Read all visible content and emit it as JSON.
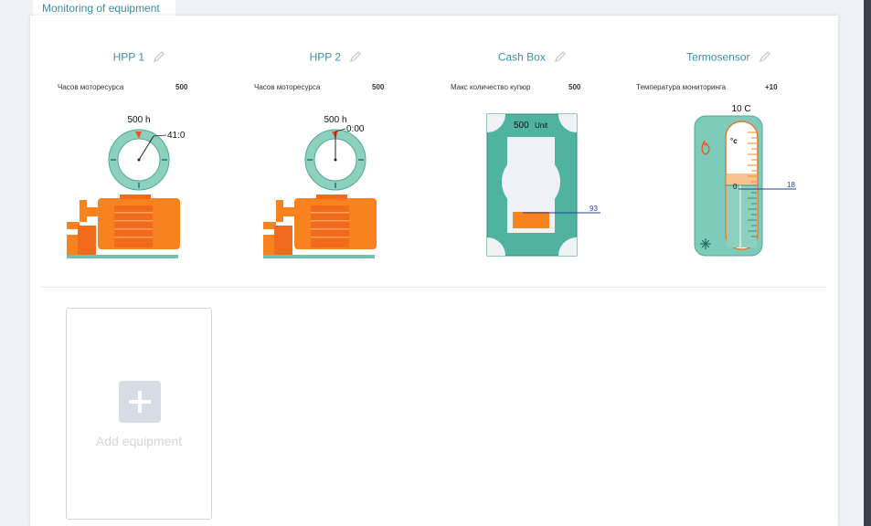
{
  "tab": {
    "label": "Monitoring of equipment"
  },
  "colors": {
    "accent": "#3d8fa8",
    "teal": "#4fb3a0",
    "orange": "#f7821e",
    "line": "#23408e"
  },
  "cards": [
    {
      "title": "HPP 1",
      "param_label": "Часов моторесурса",
      "param_value": "500",
      "gauge_label": "500 h",
      "readout": "41:0",
      "type": "pump"
    },
    {
      "title": "HPP 2",
      "param_label": "Часов моторесурса",
      "param_value": "500",
      "gauge_label": "500 h",
      "readout": "0:00",
      "type": "pump"
    },
    {
      "title": "Cash Box",
      "param_label": "Макс количество купюр",
      "param_value": "500",
      "box_label": "500",
      "box_unit": "Unit",
      "readout": "93",
      "type": "cashbox"
    },
    {
      "title": "Termosensor",
      "param_label": "Температура мониторинга",
      "param_value": "+10",
      "thermo_label": "10 C",
      "unit": "°c",
      "zero": "0",
      "readout": "18",
      "type": "thermo"
    }
  ],
  "add_equipment": {
    "label": "Add equipment"
  }
}
